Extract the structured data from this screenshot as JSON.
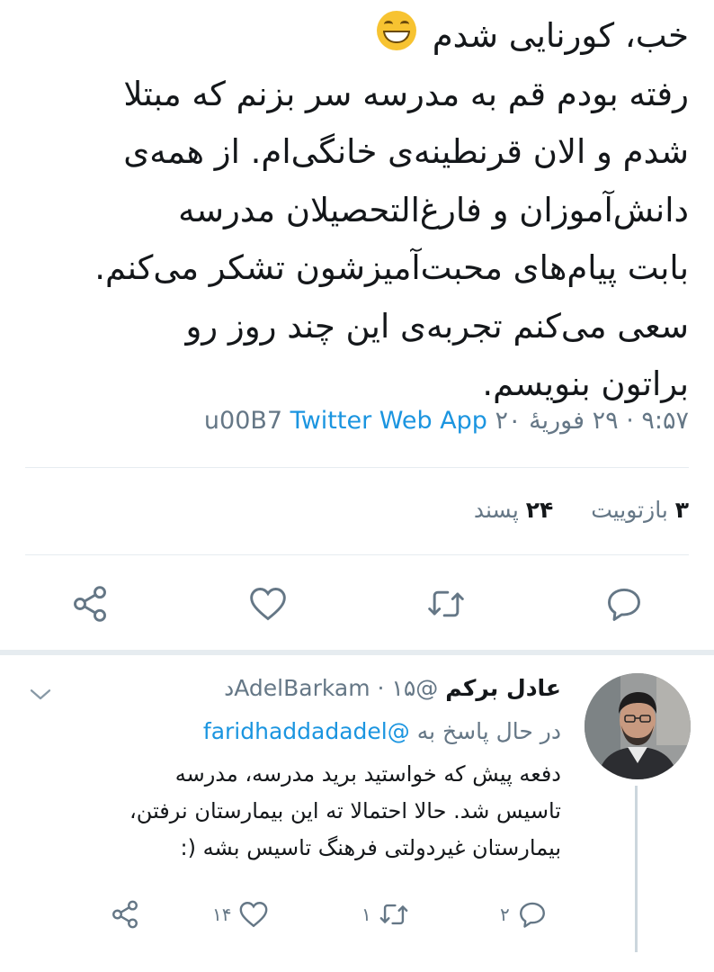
{
  "main_tweet": {
    "text_lines": [
      "خب، کورنایی شدم",
      "رفته بودم قم به مدرسه سر بزنم که مبتلا",
      "شدم و الان قرنطینه‌ی خانگی‌ام. از همه‌ی",
      "دانش‌آموزان و فارغ‌التحصیلان مدرسه",
      "بابت پیام‌های محبت‌آمیزشون تشکر می‌کنم.",
      "سعی می‌کنم تجربه‌ی این چند روز رو",
      "براتون بنویسم."
    ],
    "emoji": "grinning-squinting-face-emoji",
    "meta": {
      "time_date": "۹:۵۷ · ۲۹ فوریهٔ ۲۰",
      "separator": "u00B7",
      "app": "Twitter Web App"
    },
    "counts": {
      "retweets_number": "۳",
      "retweets_label": "بازتوییت",
      "likes_number": "۲۴",
      "likes_label": "پسند"
    },
    "actions": [
      "share-icon",
      "heart-icon",
      "retweet-icon",
      "reply-icon"
    ]
  },
  "reply": {
    "name": "عادل برکم",
    "handle": "@AdelBarkam",
    "time": "· ۱۵د",
    "replying_to_label": "در حال پاسخ به",
    "replying_to_handle": "@faridhaddadadel",
    "text_lines": [
      "دفعه پیش که خواستید برید مدرسه، مدرسه",
      "تاسیس شد. حالا احتمالا ته این بیمارستان نرفتن،",
      "بیمارستان غیردولتی فرهنگ تاسیس بشه (:"
    ],
    "reply_count": "۲",
    "retweet_count": "۱",
    "like_count": "۱۴"
  },
  "colors": {
    "link": "#1b95e0",
    "secondary_text": "#657786",
    "icon": "#657786",
    "divider": "#e6ecf0",
    "text": "#14171a"
  }
}
